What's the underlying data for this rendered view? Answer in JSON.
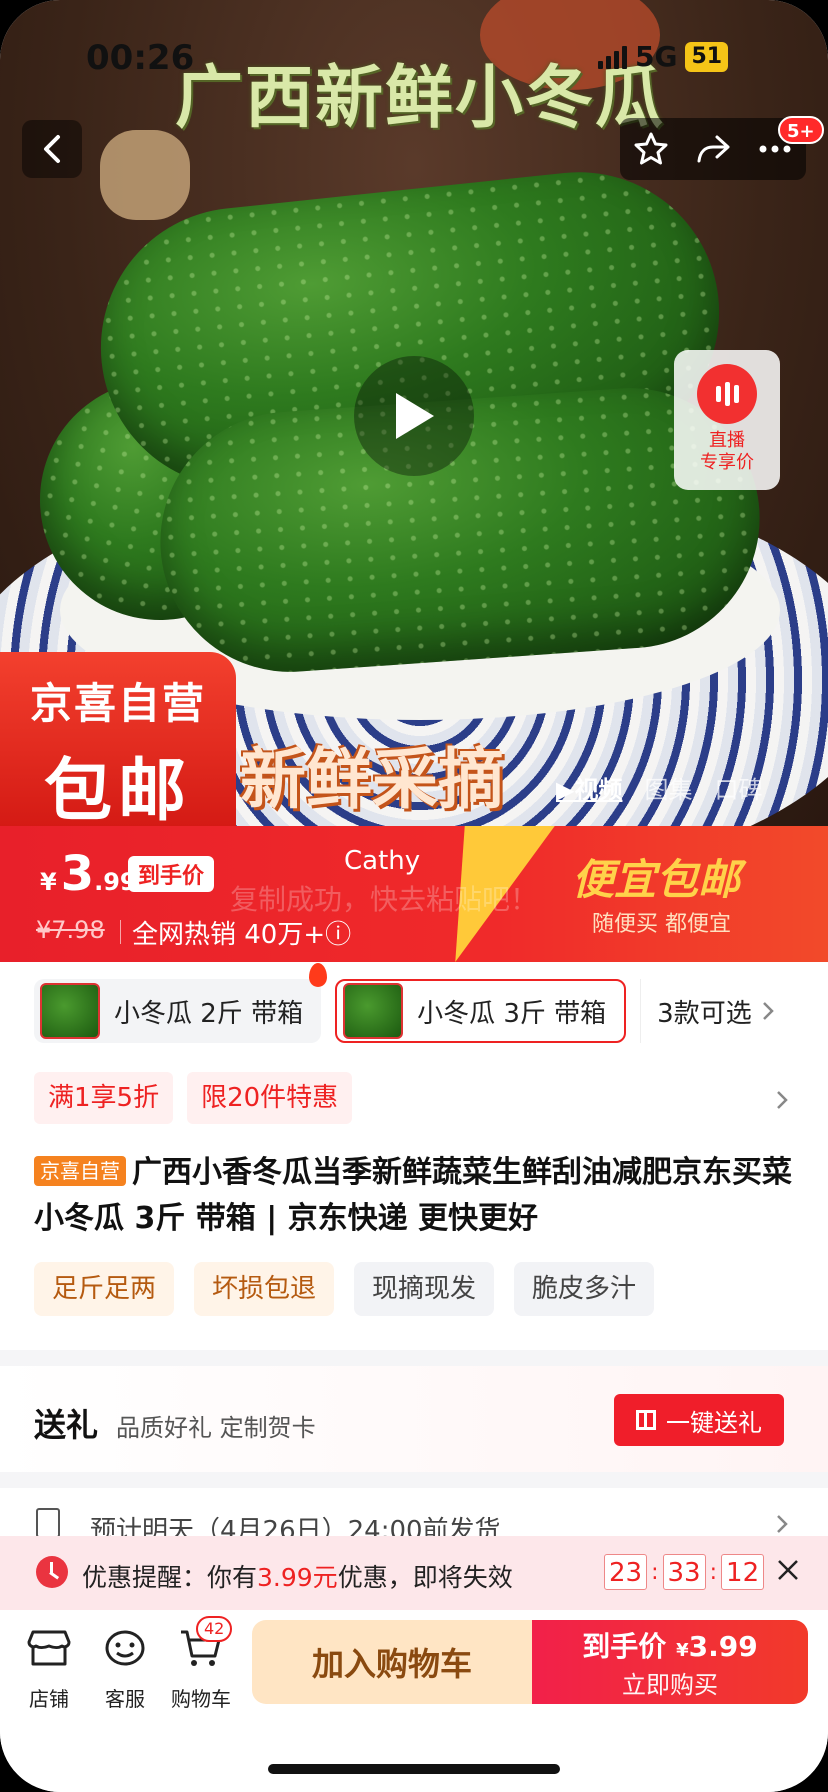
{
  "status_bar": {
    "time": "00:26",
    "network": "5G",
    "battery": "51"
  },
  "hero": {
    "title_overlay": "广西新鲜小冬瓜",
    "badge_count": "5+",
    "live_label_line1": "直播",
    "live_label_line2": "专享价",
    "brand_line1": "京喜自营",
    "brand_line2": "包邮",
    "fresh_text": "新鲜采摘",
    "media_tabs": [
      "▶视频",
      "图集",
      "口碑"
    ]
  },
  "price_bar": {
    "currency": "¥",
    "price_int": "3",
    "price_dec": ".99",
    "hand_price_tag": "到手价",
    "original_price": "¥7.98",
    "hot_sales": "全网热销 40万+ⓘ",
    "cathy_label": "Cathy",
    "faded_toast": "复制成功，快去粘贴吧！",
    "slogan_main": "便宜包邮",
    "slogan_sub": "随便买 都便宜"
  },
  "variants": [
    {
      "label": "小冬瓜 2斤 带箱",
      "selected": false,
      "hot": true
    },
    {
      "label": "小冬瓜 3斤 带箱",
      "selected": true,
      "hot": false
    }
  ],
  "more_variants": "3款可选",
  "promotions": [
    "满1享5折",
    "限20件特惠"
  ],
  "product": {
    "tag": "京喜自营",
    "title": "广西小香冬瓜当季新鲜蔬菜生鲜刮油减肥京东买菜 小冬瓜 3斤 带箱 | 京东快递 更快更好"
  },
  "feature_tags": [
    {
      "label": "足斤足两",
      "style": "warm"
    },
    {
      "label": "坏损包退",
      "style": "warm"
    },
    {
      "label": "现摘现发",
      "style": "cool"
    },
    {
      "label": "脆皮多汁",
      "style": "cool"
    }
  ],
  "gift": {
    "title": "送礼",
    "subtitle": "品质好礼 定制贺卡",
    "button": "一键送礼"
  },
  "shipping": {
    "text": "预计明天（4月26日）24:00前发货"
  },
  "reminder": {
    "prefix": "优惠提醒：你有",
    "amount": "3.99元",
    "suffix": "优惠，即将失效",
    "hours": "23",
    "minutes": "33",
    "seconds": "12"
  },
  "bottom_nav": {
    "store": "店铺",
    "service": "客服",
    "cart": "购物车",
    "cart_count": "42",
    "add_to_cart": "加入购物车",
    "buy_label": "到手价",
    "buy_currency": "¥",
    "buy_price": "3.99",
    "buy_now": "立即购买"
  },
  "colors": {
    "accent": "#f01e2a",
    "highlight": "#ffd23a"
  }
}
